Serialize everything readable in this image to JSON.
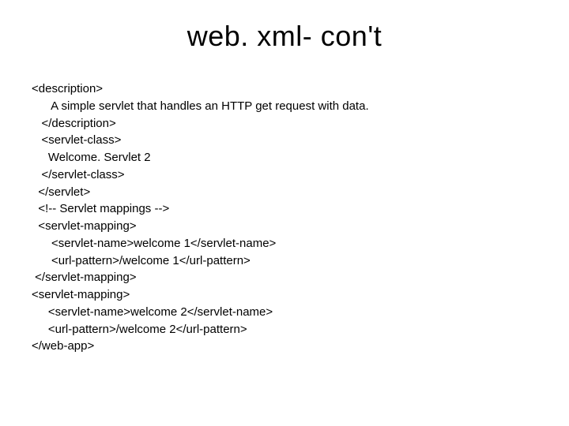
{
  "title": "web. xml- con't",
  "lines": {
    "l0": "<description>",
    "l1": "      A simple servlet that handles an HTTP get request with data.",
    "l2": "   </description>",
    "l3": "",
    "l4": "   <servlet-class>",
    "l5": "     Welcome. Servlet 2",
    "l6": "   </servlet-class>",
    "l7": "  </servlet>",
    "l8": "  <!-- Servlet mappings -->",
    "l9": "  <servlet-mapping>",
    "l10": "      <servlet-name>welcome 1</servlet-name>",
    "l11": "      <url-pattern>/welcome 1</url-pattern>",
    "l12": " </servlet-mapping>",
    "l13": "<servlet-mapping>",
    "l14": "     <servlet-name>welcome 2</servlet-name>",
    "l15": "     <url-pattern>/welcome 2</url-pattern>",
    "l16": "</web-app>"
  }
}
